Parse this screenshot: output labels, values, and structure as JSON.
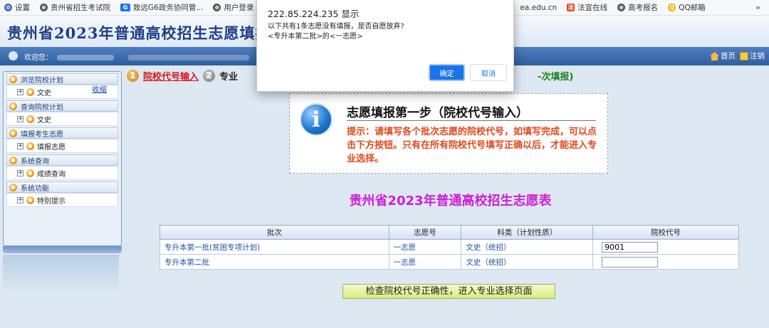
{
  "bookmarks": {
    "items": [
      {
        "icon": "gear-icon",
        "label": "设置"
      },
      {
        "icon": "globe-icon",
        "label": "贵州省招生考试院"
      },
      {
        "icon": "g6-icon",
        "label": "致远G6政务协同管..."
      },
      {
        "icon": "globe-icon",
        "label": "用户登录"
      }
    ],
    "right_items": [
      {
        "icon": "",
        "label": "ea.edu.cn"
      },
      {
        "icon": "law-icon",
        "label": "法宣在线"
      },
      {
        "icon": "globe-icon",
        "label": "高考报名"
      },
      {
        "icon": "qq-icon",
        "label": "QQ邮箱"
      }
    ],
    "more": "»"
  },
  "header": {
    "title": "贵州省2023年普通高校招生志愿填报",
    "welcome_label": "欢迎您：",
    "home_label": "首页",
    "logout_label": "注销"
  },
  "sidebar": {
    "collapse_label": "收缩",
    "groups": [
      {
        "label": "浏览院校计划",
        "item": "文史"
      },
      {
        "label": "查询院校计划",
        "item": "文史"
      },
      {
        "label": "填报考生志愿",
        "item": "填报志愿"
      },
      {
        "label": "系统查询",
        "item": "成绩查询"
      },
      {
        "label": "系统功能",
        "item": "特别提示"
      }
    ]
  },
  "steps": {
    "step1_num": "1",
    "step1_label": "院校代号输入",
    "step2_num": "2",
    "step2_label": "专业",
    "step3_tail": "-次填报)"
  },
  "info": {
    "title": "志愿填报第一步（院校代号输入）",
    "text": "提示：请填写各个批次志愿的院校代号，如填写完成，可以点击下方按钮。只有在所有院校代号填写正确以后，才能进入专业选择。"
  },
  "table": {
    "title": "贵州省2023年普通高校招生志愿表",
    "headers": [
      "批次",
      "志愿号",
      "科类（计划性质）",
      "院校代号"
    ],
    "rows": [
      {
        "batch": "专升本第一批(贫困专项计划)",
        "vol": "一志愿",
        "category": "文史（统招）",
        "code": "9001"
      },
      {
        "batch": "专升本第二批",
        "vol": "一志愿",
        "category": "文史（统招）",
        "code": ""
      }
    ]
  },
  "check_button": "检查院校代号正确性，进入专业选择页面",
  "dialog": {
    "origin": "222.85.224.235 显示",
    "message_line1": "以下共有1条志愿没有填报，是否自愿放弃?",
    "message_line2": "<专升本第二批>的<一志愿>",
    "ok_label": "确定",
    "cancel_label": "取消"
  },
  "colors": {
    "accent": "#1a73e8",
    "navbar": "#2e5e9e",
    "warning_text": "#e0481c",
    "table_title": "#cc1fd6",
    "step_active": "#d8171d"
  }
}
